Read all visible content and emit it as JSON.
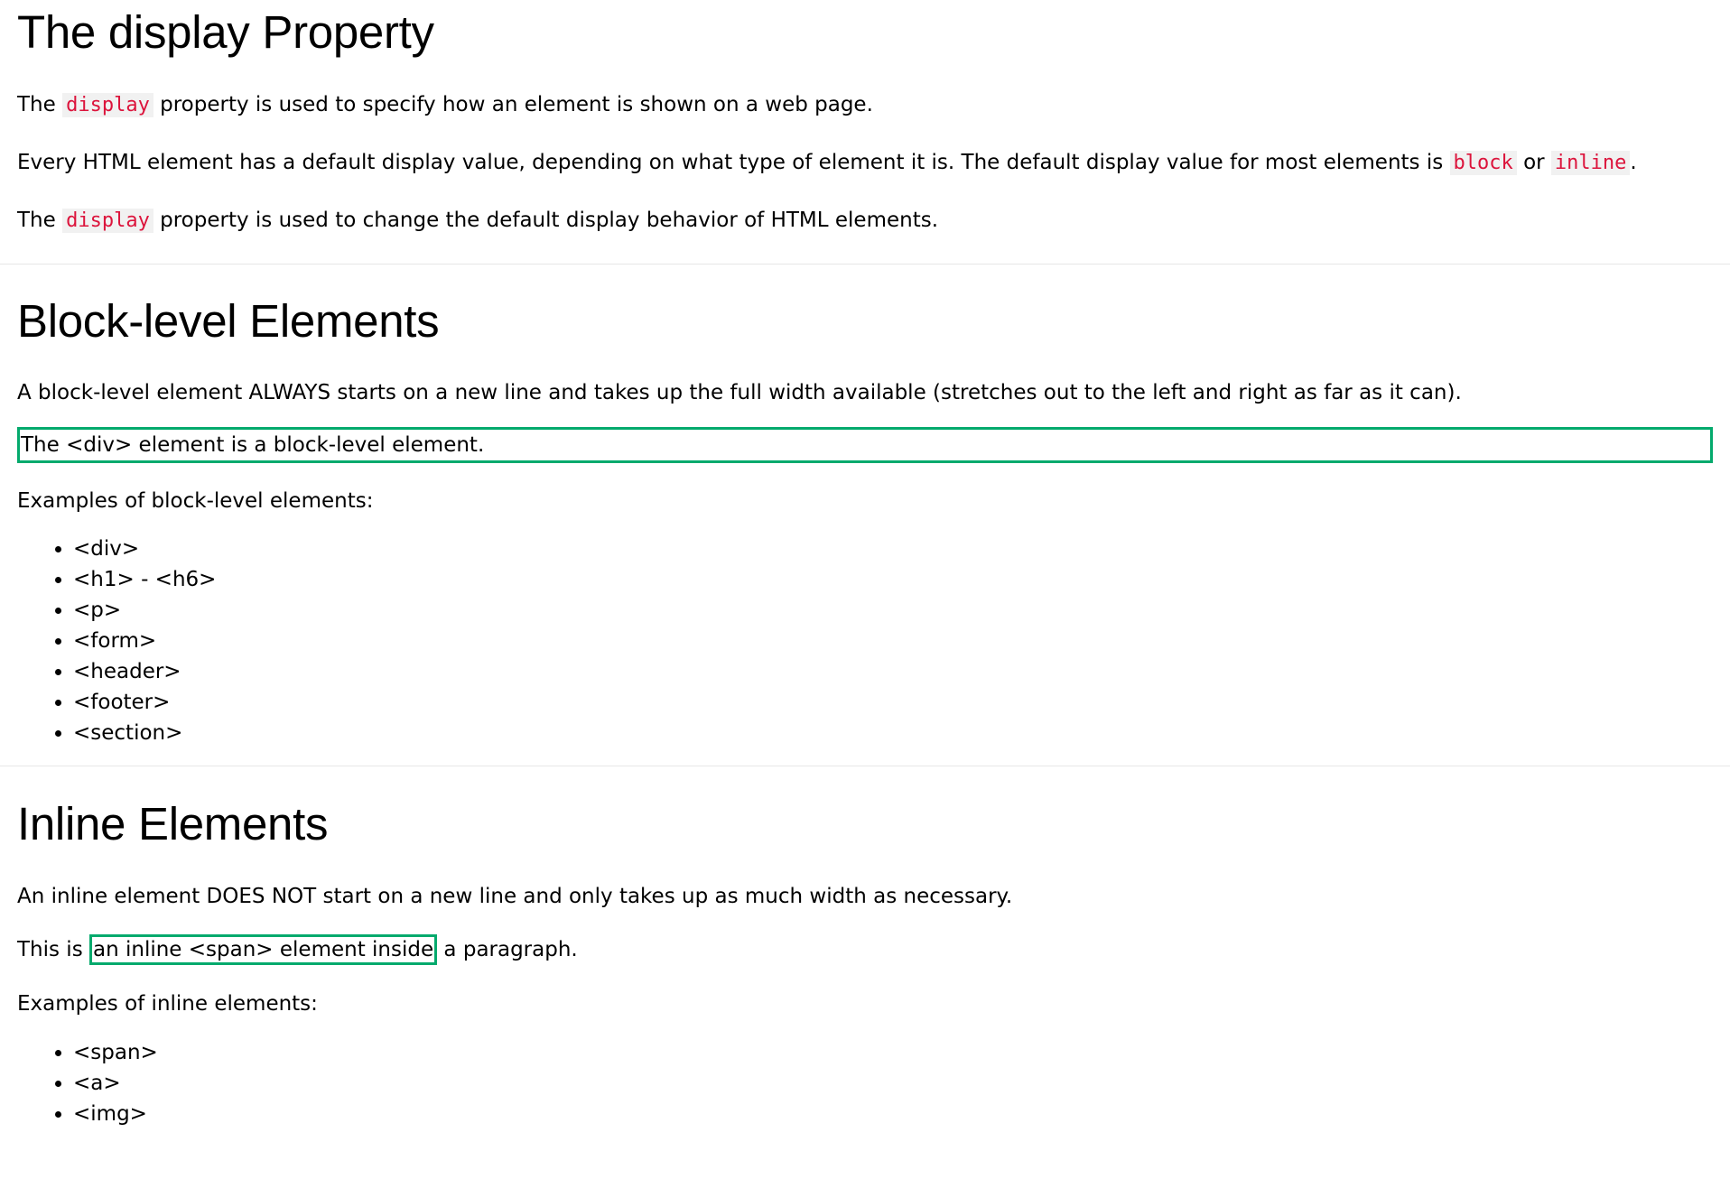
{
  "display_section": {
    "title": "The display Property",
    "p1": {
      "before": "The ",
      "code": "display",
      "after": " property is used to specify how an element is shown on a web page."
    },
    "p2": {
      "before": "Every HTML element has a default display value, depending on what type of element it is. The default display value for most elements is ",
      "code1": "block",
      "middle": " or ",
      "code2": "inline",
      "after": "."
    },
    "p3": {
      "before": "The ",
      "code": "display",
      "after": " property is used to change the default display behavior of HTML elements."
    }
  },
  "block_section": {
    "title": "Block-level Elements",
    "description": "A block-level element ALWAYS starts on a new line and takes up the full width available (stretches out to the left and right as far as it can).",
    "demo": "The <div> element is a block-level element.",
    "examples_intro": "Examples of block-level elements:",
    "examples": [
      "<div>",
      "<h1> - <h6>",
      "<p>",
      "<form>",
      "<header>",
      "<footer>",
      "<section>"
    ]
  },
  "inline_section": {
    "title": "Inline Elements",
    "description": "An inline element DOES NOT start on a new line and only takes up as much width as necessary.",
    "demo": {
      "before": "This is ",
      "span": "an inline <span> element inside",
      "after": " a paragraph."
    },
    "examples_intro": "Examples of inline elements:",
    "examples": [
      "<span>",
      "<a>",
      "<img>"
    ]
  },
  "colors": {
    "code_text": "#dc143c",
    "code_background": "#f1f1f1",
    "demo_border": "#04aa6d",
    "divider": "#e7e7e7"
  }
}
